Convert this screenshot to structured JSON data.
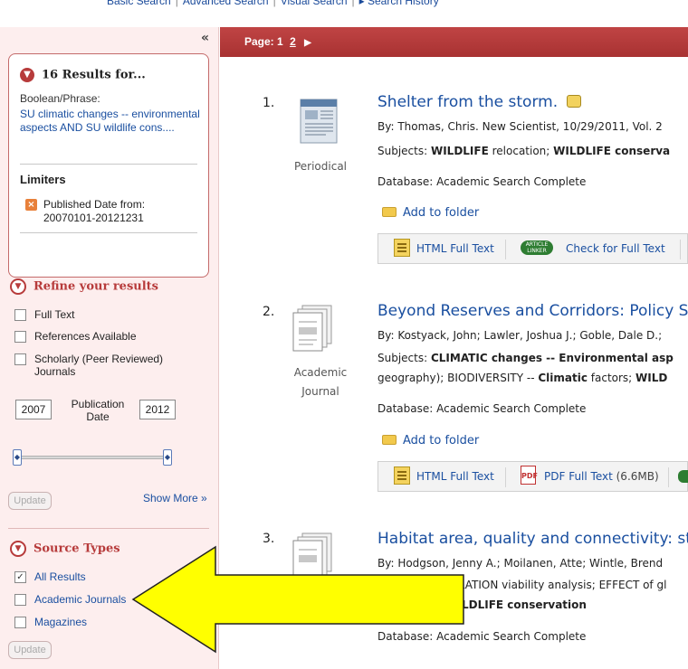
{
  "top_nav": {
    "links": [
      "Basic Search",
      "Advanced Search",
      "Visual Search",
      "Search History"
    ],
    "history_icon": "arrow-right-icon"
  },
  "sidebar": {
    "collapse_icon": "double-chevron-left-icon",
    "results_box": {
      "title": "16 Results for...",
      "query_label": "Boolean/Phrase:",
      "query_text": "SU climatic changes -- environmental aspects AND SU wildlife cons....",
      "limiters_heading": "Limiters",
      "limiter": "Published Date from: 20070101-20121231"
    },
    "refine": {
      "title": "Refine your results",
      "options": [
        {
          "label": "Full Text",
          "checked": false
        },
        {
          "label": "References Available",
          "checked": false
        },
        {
          "label": "Scholarly (Peer Reviewed)",
          "label2": "Journals",
          "checked": false
        }
      ],
      "date_from": "2007",
      "date_to": "2012",
      "date_label": "Publication Date",
      "update": "Update",
      "show_more": "Show More »"
    },
    "source_types": {
      "title": "Source Types",
      "options": [
        {
          "label": "All Results",
          "checked": true
        },
        {
          "label": "Academic Journals",
          "checked": false
        },
        {
          "label": "Magazines",
          "checked": false
        }
      ],
      "update": "Update"
    }
  },
  "main": {
    "pagination": {
      "label": "Page:",
      "current": "1",
      "next": "2"
    },
    "results": [
      {
        "number": "1.",
        "type": "Periodical",
        "title": "Shelter from the storm.",
        "byline": "By: Thomas, Chris. New Scientist, 10/29/2011, Vol. 2",
        "subjects_prefix": "Subjects: ",
        "subjects_b1": "WILDLIFE",
        "subjects_t1": " relocation; ",
        "subjects_b2": "WILDLIFE conserva",
        "database": "Database: Academic Search Complete",
        "add_to_folder": "Add to folder",
        "links": [
          "HTML Full Text",
          "Check for Full Text"
        ]
      },
      {
        "number": "2.",
        "type": "Academic Journal",
        "type_line1": "Academic",
        "type_line2": "Journal",
        "title": "Beyond Reserves and Corridors: Policy So",
        "byline": "By: Kostyack, John; Lawler, Joshua J.; Goble, Dale D.;",
        "subjects_prefix": "Subjects: ",
        "subjects_b1": "CLIMATIC changes -- Environmental asp",
        "line2_t1": "geography); BIODIVERSITY -- ",
        "line2_b1": "Climatic",
        "line2_t2": " factors; ",
        "line2_b2": "WILD",
        "database": "Database: Academic Search Complete",
        "add_to_folder": "Add to folder",
        "links": [
          "HTML Full Text",
          "PDF Full Text",
          "(6.6MB)"
        ]
      },
      {
        "number": "3.",
        "title": "Habitat area, quality and connectivity: str",
        "byline": "By: Hodgson, Jenny A.; Moilanen, Atte; Wintle, Brend",
        "line_a": "ULATION viability analysis; EFFECT of gl",
        "line_b": "LDLIFE conservation",
        "database": "Database: Academic Search Complete"
      }
    ]
  },
  "annotation": {
    "arrow_color": "#ffff00",
    "arrow_direction": "left"
  },
  "colors": {
    "accent": "#b73b3b",
    "link": "#1a4fa0",
    "sidebar_bg": "#fdeeee"
  }
}
